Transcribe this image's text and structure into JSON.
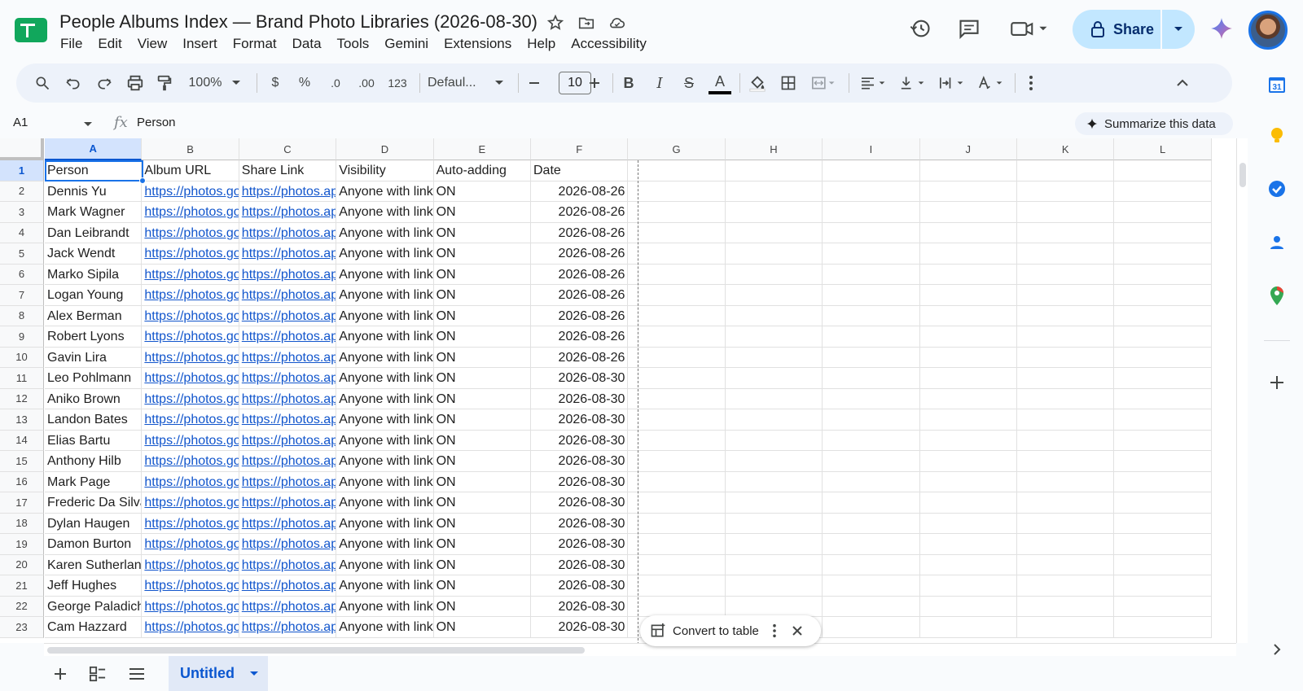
{
  "app": {
    "title": "People Albums Index — Brand Photo Libraries (2026-08-30)",
    "menu": [
      "File",
      "Edit",
      "View",
      "Insert",
      "Format",
      "Data",
      "Tools",
      "Gemini",
      "Extensions",
      "Help",
      "Accessibility"
    ],
    "share_label": "Share"
  },
  "toolbar": {
    "zoom": "100%",
    "currency": "$",
    "percent": "%",
    "dec_decrease": ".0",
    "dec_increase": ".00",
    "number_format": "123",
    "font": "Defaul...",
    "font_size": "10",
    "bold": "B",
    "italic": "I",
    "strike": "S",
    "text_color": "A"
  },
  "formula_bar": {
    "cell_ref": "A1",
    "fx": "fx",
    "value": "Person",
    "summarize_label": "Summarize this data"
  },
  "grid": {
    "columns": [
      "A",
      "B",
      "C",
      "D",
      "E",
      "F",
      "G",
      "H",
      "I",
      "J",
      "K",
      "L"
    ],
    "rows": [
      [
        "Person",
        "Album URL",
        "Share Link",
        "Visibility",
        "Auto-adding",
        "Date"
      ],
      [
        "Dennis Yu",
        "https://photos.go",
        "https://photos.ap",
        "Anyone with link",
        "ON",
        "2026-08-26"
      ],
      [
        "Mark Wagner",
        "https://photos.go",
        "https://photos.ap",
        "Anyone with link",
        "ON",
        "2026-08-26"
      ],
      [
        "Dan Leibrandt",
        "https://photos.go",
        "https://photos.ap",
        "Anyone with link",
        "ON",
        "2026-08-26"
      ],
      [
        "Jack Wendt",
        "https://photos.go",
        "https://photos.ap",
        "Anyone with link",
        "ON",
        "2026-08-26"
      ],
      [
        "Marko Sipila",
        "https://photos.go",
        "https://photos.ap",
        "Anyone with link",
        "ON",
        "2026-08-26"
      ],
      [
        "Logan Young",
        "https://photos.go",
        "https://photos.ap",
        "Anyone with link",
        "ON",
        "2026-08-26"
      ],
      [
        "Alex Berman",
        "https://photos.go",
        "https://photos.ap",
        "Anyone with link",
        "ON",
        "2026-08-26"
      ],
      [
        "Robert Lyons",
        "https://photos.go",
        "https://photos.ap",
        "Anyone with link",
        "ON",
        "2026-08-26"
      ],
      [
        "Gavin Lira",
        "https://photos.go",
        "https://photos.ap",
        "Anyone with link",
        "ON",
        "2026-08-26"
      ],
      [
        "Leo Pohlmann",
        "https://photos.go",
        "https://photos.ap",
        "Anyone with link",
        "ON",
        "2026-08-30"
      ],
      [
        "Aniko Brown",
        "https://photos.go",
        "https://photos.ap",
        "Anyone with link",
        "ON",
        "2026-08-30"
      ],
      [
        "Landon Bates",
        "https://photos.go",
        "https://photos.ap",
        "Anyone with link",
        "ON",
        "2026-08-30"
      ],
      [
        "Elias Bartu",
        "https://photos.go",
        "https://photos.ap",
        "Anyone with link",
        "ON",
        "2026-08-30"
      ],
      [
        "Anthony Hilb",
        "https://photos.go",
        "https://photos.ap",
        "Anyone with link",
        "ON",
        "2026-08-30"
      ],
      [
        "Mark Page",
        "https://photos.go",
        "https://photos.ap",
        "Anyone with link",
        "ON",
        "2026-08-30"
      ],
      [
        "Frederic Da Silva",
        "https://photos.go",
        "https://photos.ap",
        "Anyone with link",
        "ON",
        "2026-08-30"
      ],
      [
        "Dylan Haugen",
        "https://photos.go",
        "https://photos.ap",
        "Anyone with link",
        "ON",
        "2026-08-30"
      ],
      [
        "Damon Burton",
        "https://photos.go",
        "https://photos.ap",
        "Anyone with link",
        "ON",
        "2026-08-30"
      ],
      [
        "Karen Sutherland",
        "https://photos.go",
        "https://photos.ap",
        "Anyone with link",
        "ON",
        "2026-08-30"
      ],
      [
        "Jeff Hughes",
        "https://photos.go",
        "https://photos.ap",
        "Anyone with link",
        "ON",
        "2026-08-30"
      ],
      [
        "George Paladichuk",
        "https://photos.go",
        "https://photos.ap",
        "Anyone with link",
        "ON",
        "2026-08-30"
      ],
      [
        "Cam Hazzard",
        "https://photos.go",
        "https://photos.ap",
        "Anyone with link",
        "ON",
        "2026-08-30"
      ]
    ]
  },
  "convert_to_table": {
    "label": "Convert to table"
  },
  "sheets": {
    "active": "Untitled"
  },
  "side_panel": {
    "calendar_day": "31"
  },
  "colors": {
    "accent": "#0b57d0",
    "share_bg": "#c2e7ff",
    "link": "#1155cc",
    "sheets_green": "#11a75c"
  }
}
